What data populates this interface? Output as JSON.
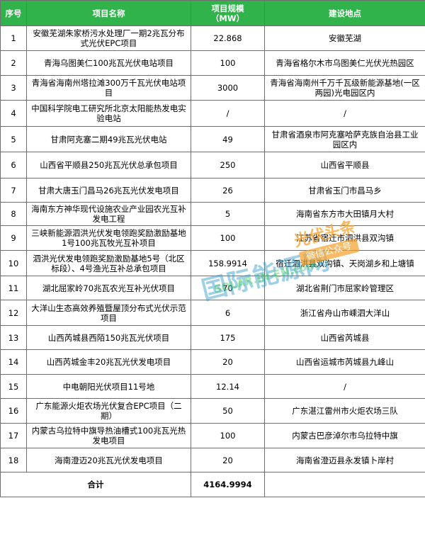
{
  "headers": {
    "no": "序号",
    "name": "项目名称",
    "scale_line1": "项目规模",
    "scale_line2": "（MW）",
    "site": "建设地点"
  },
  "rows": [
    {
      "no": "1",
      "name": "安徽芜湖朱家桥污水处理厂一期2兆瓦分布式光伏EPC项目",
      "scale": "22.868",
      "site": "安徽芜湖"
    },
    {
      "no": "2",
      "name": "青海乌图美仁100兆瓦光伏电站项目",
      "scale": "100",
      "site": "青海省格尔木市乌图美仁光伏光热园区"
    },
    {
      "no": "3",
      "name": "青海省海南州塔拉滩300万千瓦光伏电站项目",
      "scale": "3000",
      "site": "青海省海南州千万千瓦级新能源基地(一区两园)光电园区内"
    },
    {
      "no": "4",
      "name": "中国科学院电工研究所北京太阳能热发电实验电站",
      "scale": "/",
      "site": "/"
    },
    {
      "no": "5",
      "name": "甘肃阿克塞二期49兆瓦光伏电站",
      "scale": "49",
      "site": "甘肃省酒泉市阿克塞哈萨克族自治县工业园区内"
    },
    {
      "no": "6",
      "name": "山西省平顺县250兆瓦光伏总承包项目",
      "scale": "250",
      "site": "山西省平顺县"
    },
    {
      "no": "7",
      "name": "甘肃大唐玉门昌马26兆瓦光伏发电项目",
      "scale": "26",
      "site": "甘肃省玉门市昌马乡"
    },
    {
      "no": "8",
      "name": "海南东方神华现代设施农业产业园农光互补发电工程",
      "scale": "5",
      "site": "海南省东方市大田镇月大村"
    },
    {
      "no": "9",
      "name": "三峡新能源泗洪光伏发电领跑奖励激励基地1号100兆瓦牧光互补项目",
      "scale": "100",
      "site": "江苏省宿迁市泗洪县双沟镇"
    },
    {
      "no": "10",
      "name": "泗洪光伏发电领跑奖励激励基地5号（北区标段）、4号渔光互补总承包项目",
      "scale": "158.9914",
      "site": "宿迁泗洪县双沟镇、天岗湖乡和上塘镇"
    },
    {
      "no": "11",
      "name": "湖北屈家岭70兆瓦农光互补光伏项目",
      "scale": "70",
      "site": "湖北省荆门市屈家岭管理区"
    },
    {
      "no": "12",
      "name": "大洋山生态高效养殖暨屋顶分布式光伏示范项目",
      "scale": "6",
      "site": "浙江省舟山市嵊泗大洋山"
    },
    {
      "no": "13",
      "name": "山西芮城县西陌150兆瓦光伏项目",
      "scale": "175",
      "site": "山西省芮城县"
    },
    {
      "no": "14",
      "name": "山西芮城金丰20兆瓦光伏发电项目",
      "scale": "20",
      "site": "山西省运城市芮城县九峰山"
    },
    {
      "no": "15",
      "name": "中电朝阳光伏项目11号地",
      "scale": "12.14",
      "site": "/"
    },
    {
      "no": "16",
      "name": "广东能源火炬农场光伏复合EPC项目（二期）",
      "scale": "50",
      "site": "广东湛江雷州市火炬农场三队"
    },
    {
      "no": "17",
      "name": "内蒙古乌拉特中旗导热油槽式100兆瓦光热发电项目",
      "scale": "100",
      "site": "内蒙古巴彦淖尔市乌拉特中旗"
    },
    {
      "no": "18",
      "name": "海南澄迈20兆瓦光伏发电项目",
      "scale": "20",
      "site": "海南省澄迈县永发镇卜岸村"
    }
  ],
  "total": {
    "label": "合计",
    "value": "4164.9994"
  },
  "watermark": {
    "site": "SOLAR.IN-EN.com",
    "name": "国际能源网",
    "badge_line1": "光伏头条",
    "badge_line2": "微信公众号"
  },
  "colors": {
    "header_bg": "#2fb34a",
    "header_text": "#ffffff",
    "total_value": "#e8262b",
    "border": "#6f6f6f"
  }
}
